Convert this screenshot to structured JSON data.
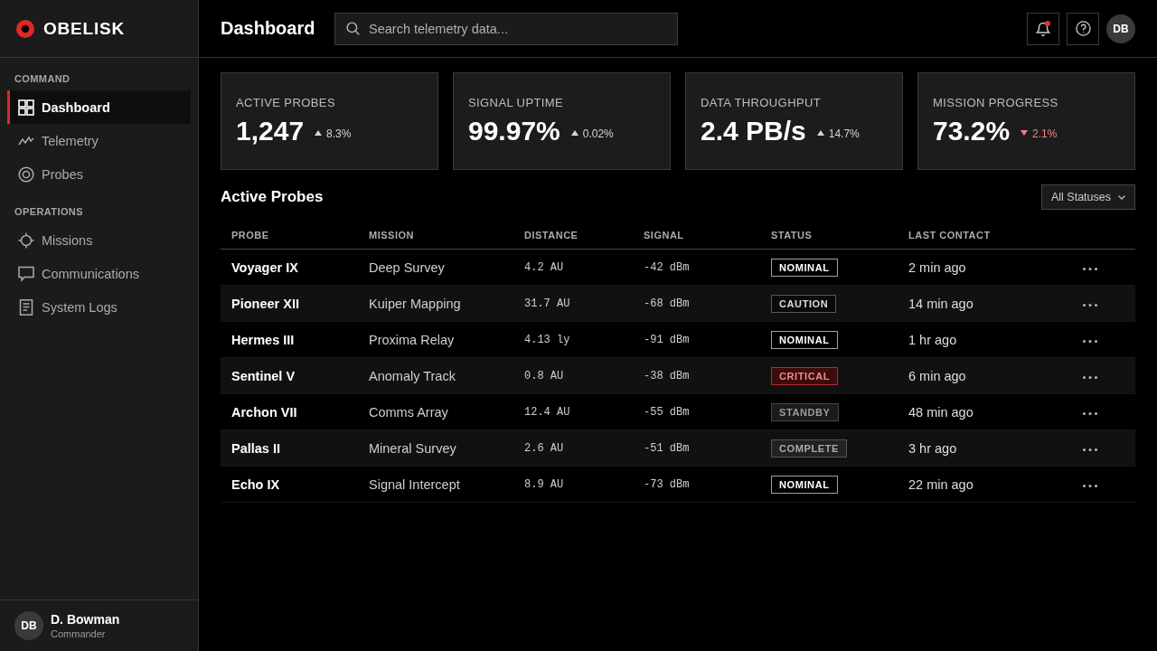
{
  "sidebar": {
    "logo": "OBELISK",
    "sections": [
      {
        "heading": "COMMAND",
        "items": [
          {
            "label": "Dashboard",
            "selected": true
          },
          {
            "label": "Telemetry",
            "selected": false
          },
          {
            "label": "Probes",
            "selected": false
          }
        ]
      },
      {
        "heading": "OPERATIONS",
        "items": [
          {
            "label": "Missions",
            "selected": false
          },
          {
            "label": "Communications",
            "selected": false
          },
          {
            "label": "System Logs",
            "selected": false
          }
        ]
      }
    ],
    "user": {
      "initials": "DB",
      "name": "D. Bowman",
      "role": "Commander"
    }
  },
  "header": {
    "title": "Dashboard",
    "search": {
      "placeholder": "Search telemetry data..."
    },
    "notifications_unread": true,
    "avatar_initials": "DB"
  },
  "stats": [
    {
      "label": "ACTIVE PROBES",
      "value": "1,247",
      "delta": "8.3%",
      "rising": true
    },
    {
      "label": "SIGNAL UPTIME",
      "value": "99.97%",
      "delta": "0.02%",
      "rising": true
    },
    {
      "label": "DATA THROUGHPUT",
      "value": "2.4 PB/s",
      "delta": "14.7%",
      "rising": true
    },
    {
      "label": "MISSION PROGRESS",
      "value": "73.2%",
      "delta": "2.1%",
      "rising": false
    }
  ],
  "probes": {
    "title": "Active Probes",
    "filter": "All Statuses",
    "columns": [
      "PROBE",
      "MISSION",
      "DISTANCE",
      "SIGNAL",
      "STATUS",
      "LAST CONTACT"
    ],
    "rows": [
      {
        "probe": "Voyager IX",
        "mission": "Deep Survey",
        "distance": "4.2 AU",
        "signal": "-42 dBm",
        "status": {
          "label": "NOMINAL",
          "kind": "nominal"
        },
        "last_contact": "2 min ago"
      },
      {
        "probe": "Pioneer XII",
        "mission": "Kuiper Mapping",
        "distance": "31.7 AU",
        "signal": "-68 dBm",
        "status": {
          "label": "CAUTION",
          "kind": "caution"
        },
        "last_contact": "14 min ago"
      },
      {
        "probe": "Hermes III",
        "mission": "Proxima Relay",
        "distance": "4.13 ly",
        "signal": "-91 dBm",
        "status": {
          "label": "NOMINAL",
          "kind": "nominal"
        },
        "last_contact": "1 hr ago"
      },
      {
        "probe": "Sentinel V",
        "mission": "Anomaly Track",
        "distance": "0.8 AU",
        "signal": "-38 dBm",
        "status": {
          "label": "CRITICAL",
          "kind": "critical"
        },
        "last_contact": "6 min ago"
      },
      {
        "probe": "Archon VII",
        "mission": "Comms Array",
        "distance": "12.4 AU",
        "signal": "-55 dBm",
        "status": {
          "label": "STANDBY",
          "kind": "standby"
        },
        "last_contact": "48 min ago"
      },
      {
        "probe": "Pallas II",
        "mission": "Mineral Survey",
        "distance": "2.6 AU",
        "signal": "-51 dBm",
        "status": {
          "label": "COMPLETE",
          "kind": "complete"
        },
        "last_contact": "3 hr ago"
      },
      {
        "probe": "Echo IX",
        "mission": "Signal Intercept",
        "distance": "8.9 AU",
        "signal": "-73 dBm",
        "status": {
          "label": "NOMINAL",
          "kind": "nominal"
        },
        "last_contact": "22 min ago"
      }
    ]
  }
}
